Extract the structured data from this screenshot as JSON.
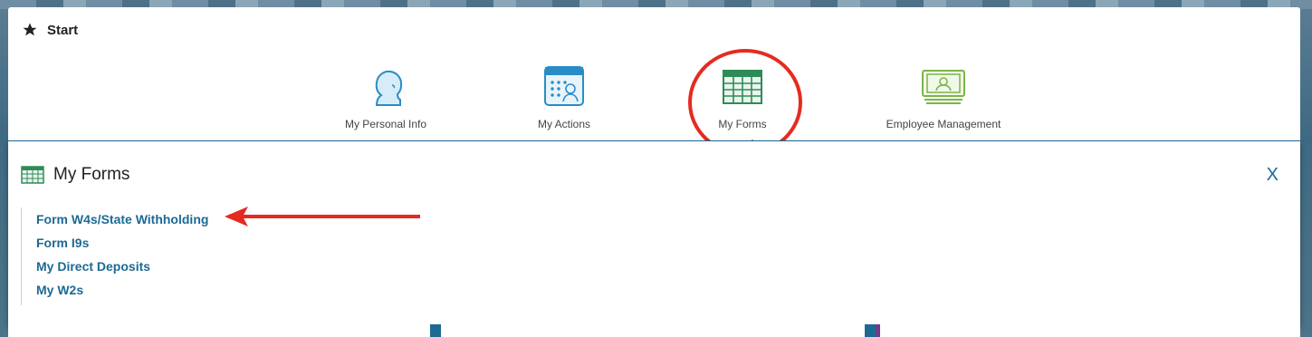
{
  "start": {
    "title": "Start"
  },
  "tiles": [
    {
      "label": "My Personal Info",
      "color": "#2a8cc7"
    },
    {
      "label": "My Actions",
      "color": "#2a8cc7"
    },
    {
      "label": "My Forms",
      "color": "#2e8b57"
    },
    {
      "label": "Employee Management",
      "color": "#7ab648"
    }
  ],
  "forms_panel": {
    "title": "My Forms",
    "close_label": "X",
    "links": [
      "Form W4s/State Withholding",
      "Form I9s",
      "My Direct Deposits",
      "My W2s"
    ]
  },
  "annotations": {
    "highlight_color": "#e52b21"
  },
  "colors": {
    "link": "#1c6a94",
    "accent": "#1c6a94"
  }
}
